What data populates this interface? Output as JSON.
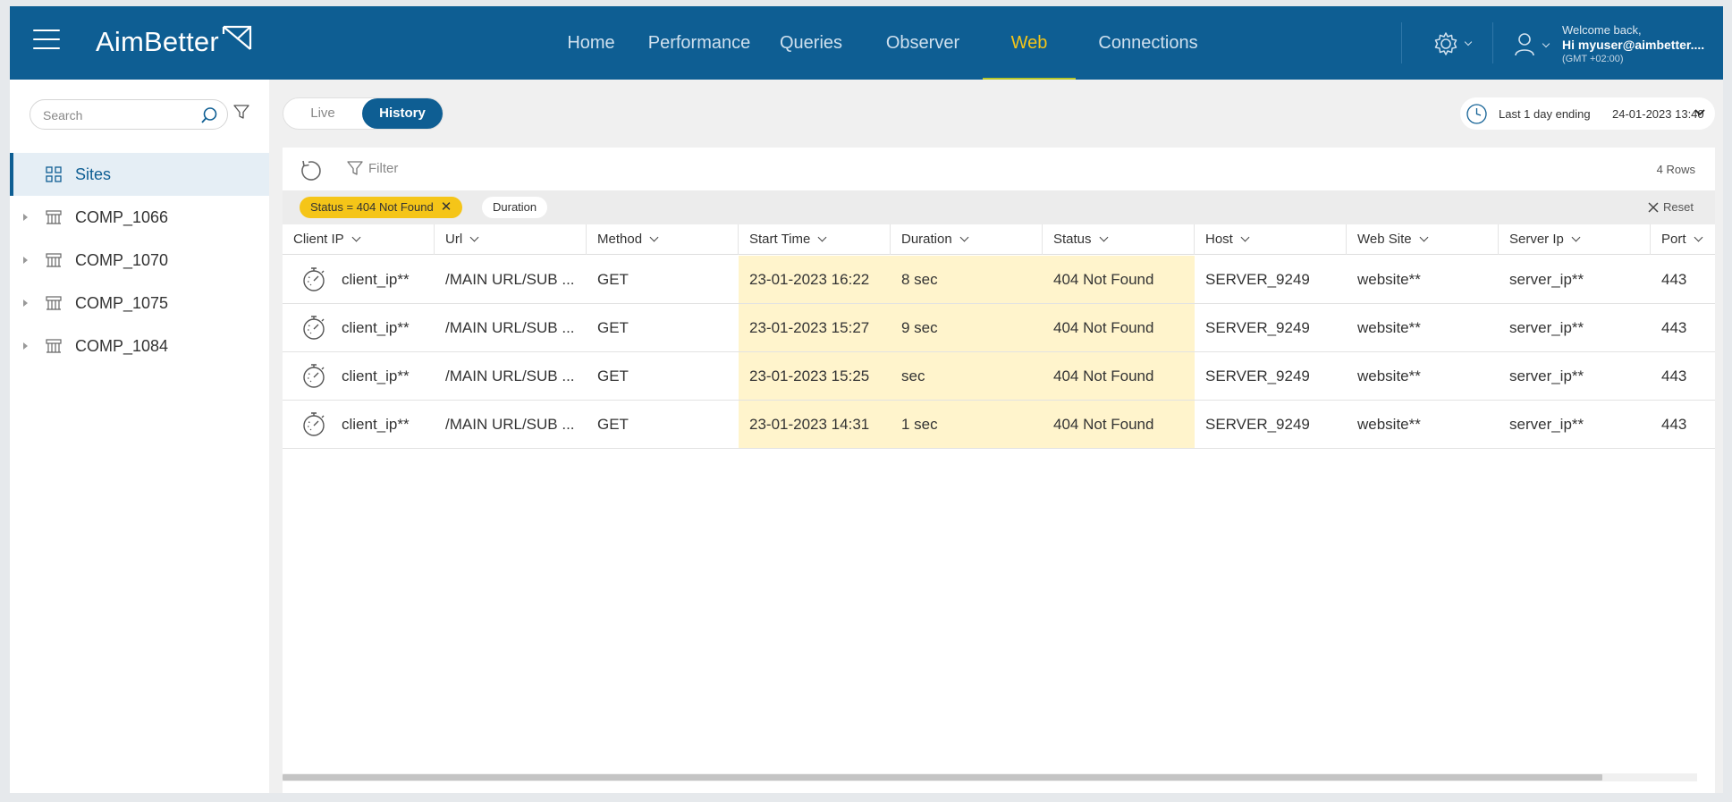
{
  "app": {
    "logo_text": "AimBetter",
    "brand_color": "#0e5e93",
    "accent_color": "#f5c518"
  },
  "nav": {
    "items": [
      {
        "label": "Home",
        "active": false
      },
      {
        "label": "Performance",
        "active": false
      },
      {
        "label": "Queries",
        "active": false
      },
      {
        "label": "Observer",
        "active": false
      },
      {
        "label": "Web",
        "active": true
      },
      {
        "label": "Connections",
        "active": false
      }
    ]
  },
  "user": {
    "welcome": "Welcome back,",
    "greeting": "Hi myuser@aimbetter....",
    "timezone": "(GMT +02:00)"
  },
  "sidebar": {
    "search_placeholder": "Search",
    "items": [
      {
        "label": "Sites",
        "icon": "grid-icon",
        "selected": true
      },
      {
        "label": "COMP_1066",
        "icon": "server-icon",
        "selected": false
      },
      {
        "label": "COMP_1070",
        "icon": "server-icon",
        "selected": false
      },
      {
        "label": "COMP_1075",
        "icon": "server-icon",
        "selected": false
      },
      {
        "label": "COMP_1084",
        "icon": "server-icon",
        "selected": false
      }
    ]
  },
  "mode": {
    "live_label": "Live",
    "history_label": "History",
    "selected": "History"
  },
  "time_range": {
    "label": "Last 1 day ending",
    "value": "24-01-2023 13:40"
  },
  "toolbar": {
    "filter_label": "Filter",
    "rows_count": "4 Rows",
    "reset_label": "Reset"
  },
  "chips": {
    "status": "Status = 404 Not Found",
    "duration": "Duration"
  },
  "table": {
    "columns": [
      "Client IP",
      "Url",
      "Method",
      "Start Time",
      "Duration",
      "Status",
      "Host",
      "Web Site",
      "Server Ip",
      "Port"
    ],
    "highlighted_columns": [
      "Start Time",
      "Duration",
      "Status"
    ],
    "rows": [
      {
        "client_ip": "client_ip**",
        "url": "/MAIN URL/SUB ...",
        "method": "GET",
        "start_time": "23-01-2023 16:22",
        "duration": "8 sec",
        "status": "404 Not Found",
        "host": "SERVER_9249",
        "web_site": "website**",
        "server_ip": "server_ip**",
        "port": "443"
      },
      {
        "client_ip": "client_ip**",
        "url": "/MAIN URL/SUB ...",
        "method": "GET",
        "start_time": "23-01-2023 15:27",
        "duration": "9 sec",
        "status": "404 Not Found",
        "host": "SERVER_9249",
        "web_site": "website**",
        "server_ip": "server_ip**",
        "port": "443"
      },
      {
        "client_ip": "client_ip**",
        "url": "/MAIN URL/SUB ...",
        "method": "GET",
        "start_time": "23-01-2023 15:25",
        "duration": "sec",
        "status": "404 Not Found",
        "host": "SERVER_9249",
        "web_site": "website**",
        "server_ip": "server_ip**",
        "port": "443"
      },
      {
        "client_ip": "client_ip**",
        "url": "/MAIN URL/SUB ...",
        "method": "GET",
        "start_time": "23-01-2023 14:31",
        "duration": "1 sec",
        "status": "404 Not Found",
        "host": "SERVER_9249",
        "web_site": "website**",
        "server_ip": "server_ip**",
        "port": "443"
      }
    ]
  }
}
